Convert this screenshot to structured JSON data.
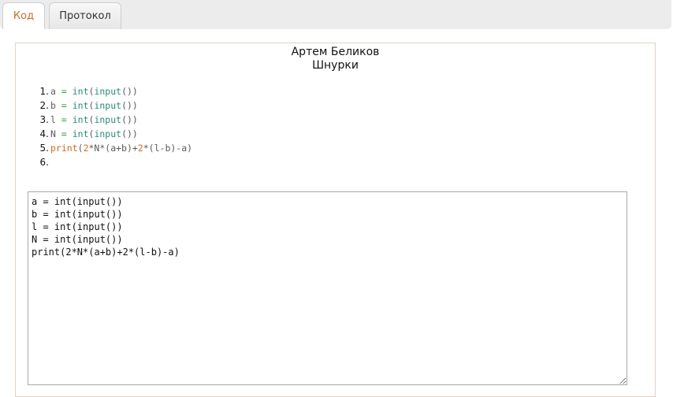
{
  "tabs": [
    {
      "label": "Код",
      "active": true
    },
    {
      "label": "Протокол",
      "active": false
    }
  ],
  "submission": {
    "author": "Артем Беликов",
    "problem": "Шнурки"
  },
  "code_lines": [
    {
      "number": "1.",
      "tokens": [
        {
          "t": "a",
          "c": "v"
        },
        {
          "t": " = ",
          "c": "o"
        },
        {
          "t": "int",
          "c": "f"
        },
        {
          "t": "(",
          "c": "v"
        },
        {
          "t": "input",
          "c": "f"
        },
        {
          "t": "())",
          "c": "v"
        }
      ]
    },
    {
      "number": "2.",
      "tokens": [
        {
          "t": "b",
          "c": "v"
        },
        {
          "t": " = ",
          "c": "o"
        },
        {
          "t": "int",
          "c": "f"
        },
        {
          "t": "(",
          "c": "v"
        },
        {
          "t": "input",
          "c": "f"
        },
        {
          "t": "())",
          "c": "v"
        }
      ]
    },
    {
      "number": "3.",
      "tokens": [
        {
          "t": "l",
          "c": "v"
        },
        {
          "t": " = ",
          "c": "o"
        },
        {
          "t": "int",
          "c": "f"
        },
        {
          "t": "(",
          "c": "v"
        },
        {
          "t": "input",
          "c": "f"
        },
        {
          "t": "())",
          "c": "v"
        }
      ]
    },
    {
      "number": "4.",
      "tokens": [
        {
          "t": "N",
          "c": "v"
        },
        {
          "t": " = ",
          "c": "o"
        },
        {
          "t": "int",
          "c": "f"
        },
        {
          "t": "(",
          "c": "v"
        },
        {
          "t": "input",
          "c": "f"
        },
        {
          "t": "())",
          "c": "v"
        }
      ]
    },
    {
      "number": "5.",
      "tokens": [
        {
          "t": "print",
          "c": "k"
        },
        {
          "t": "(",
          "c": "v"
        },
        {
          "t": "2",
          "c": "n"
        },
        {
          "t": "*N*(a+b)+",
          "c": "v"
        },
        {
          "t": "2",
          "c": "n"
        },
        {
          "t": "*(l-b)-a)",
          "c": "v"
        }
      ]
    },
    {
      "number": "6.",
      "tokens": []
    }
  ],
  "editor": {
    "value": "a = int(input())\nb = int(input())\nl = int(input())\nN = int(input())\nprint(2*N*(a+b)+2*(l-b)-a)"
  },
  "colors": {
    "active_tab_text": "#c0712f",
    "operator": "#3a9a3a",
    "builtin": "#2a8a7a",
    "keyword": "#d2691e",
    "number": "#e8651a"
  }
}
